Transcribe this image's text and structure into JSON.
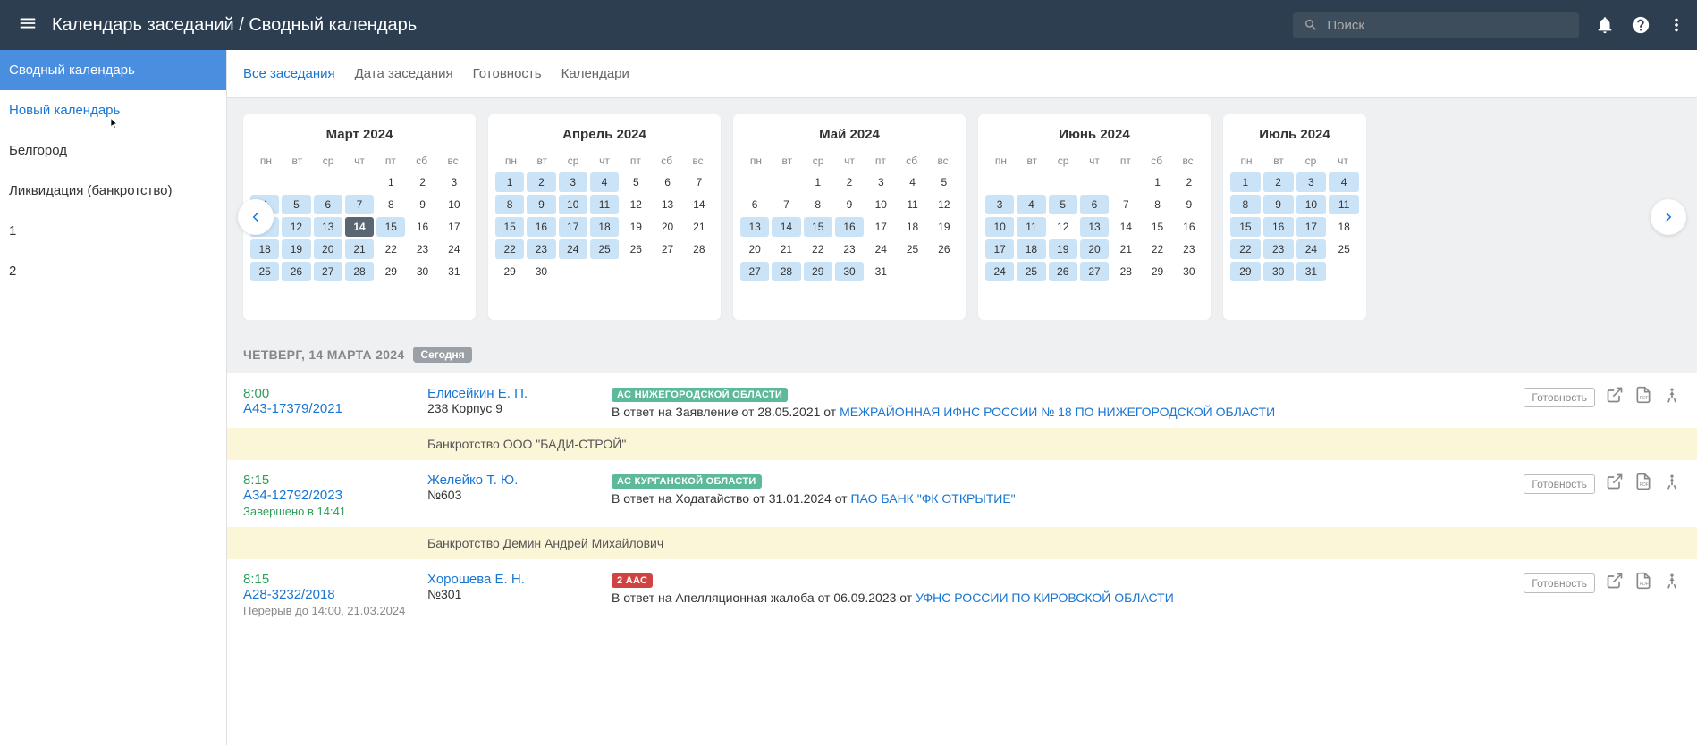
{
  "header": {
    "title": "Календарь заседаний / Сводный календарь",
    "search_placeholder": "Поиск"
  },
  "sidebar": {
    "items": [
      {
        "label": "Сводный календарь",
        "active": true
      },
      {
        "label": "Новый календарь",
        "link": true
      },
      {
        "label": "Белгород"
      },
      {
        "label": "Ликвидация (банкротство)"
      },
      {
        "label": "1"
      },
      {
        "label": "2"
      }
    ]
  },
  "tabs": [
    {
      "label": "Все заседания",
      "active": true
    },
    {
      "label": "Дата заседания"
    },
    {
      "label": "Готовность"
    },
    {
      "label": "Календари"
    }
  ],
  "weekdays": [
    "пн",
    "вт",
    "ср",
    "чт",
    "пт",
    "сб",
    "вс"
  ],
  "months": [
    {
      "title": "Март 2024",
      "start": 4,
      "days": 31,
      "highlighted": [
        4,
        5,
        6,
        7,
        11,
        12,
        13,
        14,
        15,
        18,
        19,
        20,
        21,
        25,
        26,
        27,
        28
      ],
      "today": 14
    },
    {
      "title": "Апрель 2024",
      "start": 0,
      "days": 30,
      "highlighted": [
        1,
        2,
        3,
        4,
        8,
        9,
        10,
        11,
        15,
        16,
        17,
        18,
        22,
        23,
        24,
        25
      ]
    },
    {
      "title": "Май 2024",
      "start": 2,
      "days": 31,
      "highlighted": [
        13,
        14,
        15,
        16,
        27,
        28,
        29,
        30
      ]
    },
    {
      "title": "Июнь 2024",
      "start": 5,
      "days": 30,
      "highlighted": [
        3,
        4,
        5,
        6,
        10,
        11,
        13,
        17,
        18,
        19,
        20,
        24,
        25,
        26,
        27
      ]
    },
    {
      "title": "Июль 2024",
      "start": 0,
      "days": 31,
      "highlighted": [
        1,
        2,
        3,
        4,
        8,
        9,
        10,
        11,
        15,
        16,
        17,
        22,
        23,
        24,
        29,
        30,
        31
      ],
      "partial": true
    }
  ],
  "date_header": {
    "text": "ЧЕТВЕРГ, 14 МАРТА 2024",
    "today_label": "Сегодня"
  },
  "ready_button": "Готовность",
  "events": [
    {
      "time": "8:00",
      "case": "А43-17379/2021",
      "judge": "Елисейкин Е. П.",
      "room": "238 Корпус 9",
      "badge": "АС НИЖЕГОРОДСКОЙ ОБЛАСТИ",
      "badge_class": "",
      "desc_pre": "В ответ на Заявление от 28.05.2021 от ",
      "desc_link": "МЕЖРАЙОННАЯ ИФНС РОССИИ № 18 ПО НИЖЕГОРОДСКОЙ ОБЛАСТИ",
      "divider": "Банкротство ООО \"БАДИ-СТРОЙ\""
    },
    {
      "time": "8:15",
      "case": "А34-12792/2023",
      "finished": "Завершено в 14:41",
      "judge": "Желейко Т. Ю.",
      "room": "№603",
      "badge": "АС КУРГАНСКОЙ ОБЛАСТИ",
      "badge_class": "",
      "desc_pre": "В ответ на Ходатайство от 31.01.2024 от ",
      "desc_link": "ПАО БАНК \"ФК ОТКРЫТИЕ\"",
      "divider": "Банкротство Демин Андрей Михайлович"
    },
    {
      "time": "8:15",
      "case": "А28-3232/2018",
      "reschedule": "Перерыв до 14:00, 21.03.2024",
      "judge": "Хорошева Е. Н.",
      "room": "№301",
      "badge": "2 ААС",
      "badge_class": "red",
      "desc_pre": "В ответ на Апелляционная жалоба от 06.09.2023 от ",
      "desc_link": "УФНС РОССИИ ПО КИРОВСКОЙ ОБЛАСТИ"
    }
  ]
}
